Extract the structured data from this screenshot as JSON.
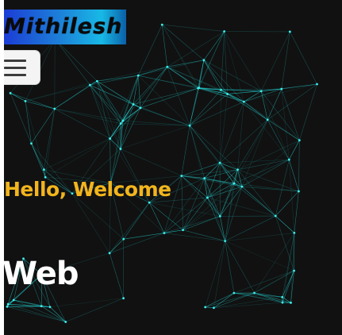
{
  "header": {
    "logo_text": "Mithilesh",
    "menu_icon": "hamburger-menu-icon"
  },
  "hero": {
    "greeting": "Hello, Welcome",
    "headline": "Web"
  },
  "colors": {
    "background": "#111111",
    "network_line": "#27e6e6",
    "greeting": "#f2b51c",
    "headline": "#ffffff",
    "logo_gradient_start": "#1b3dd6",
    "logo_gradient_end": "#18b9e6"
  }
}
